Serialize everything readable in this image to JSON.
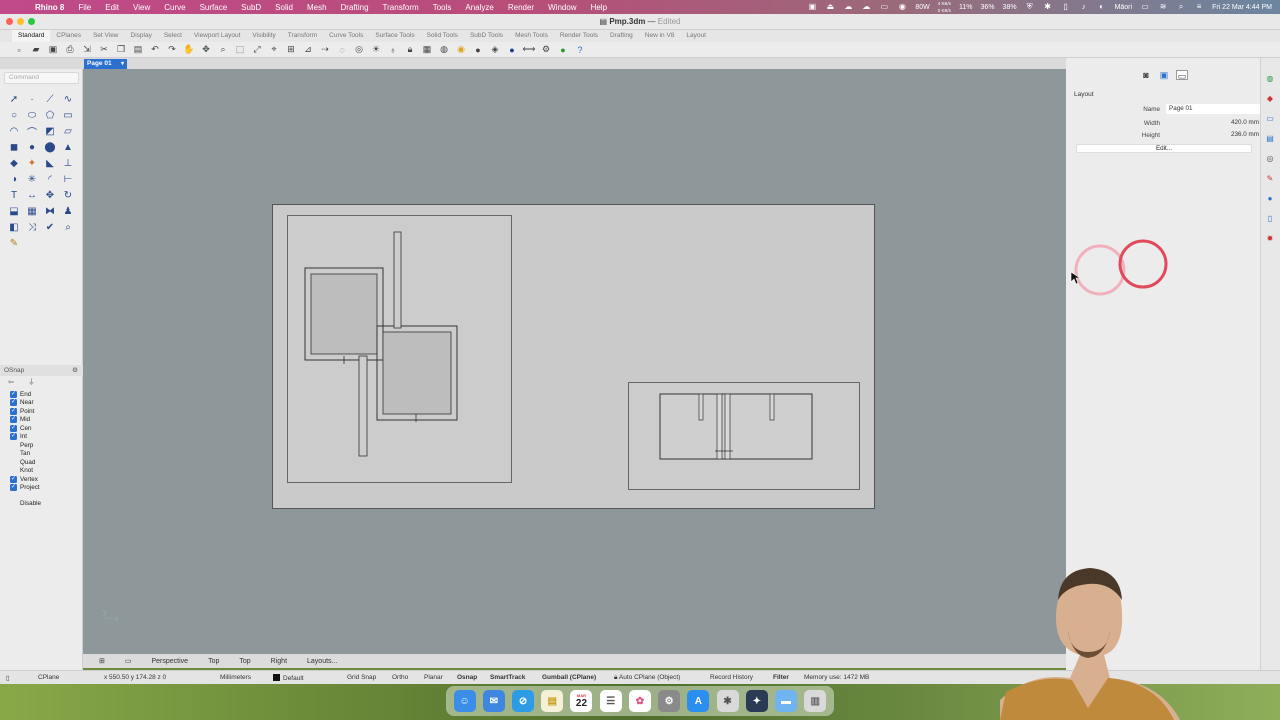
{
  "menubar": {
    "app": "Rhino 8",
    "items": [
      "File",
      "Edit",
      "View",
      "Curve",
      "Surface",
      "SubD",
      "Solid",
      "Mesh",
      "Drafting",
      "Transform",
      "Tools",
      "Analyze",
      "Render",
      "Window",
      "Help"
    ],
    "net_up": "4 KB/s",
    "net_down": "0 KB/s",
    "cpu_pct": "11%",
    "mem_pct": "36%",
    "other_pct": "38%",
    "battery_w": "80W",
    "keyboard": "Māori",
    "datetime": "Fri 22 Mar  4:44 PM"
  },
  "titlebar": {
    "filename": "Pmp.3dm",
    "status": "Edited"
  },
  "toolbar_tabs": [
    "Standard",
    "CPlanes",
    "Set View",
    "Display",
    "Select",
    "Viewport Layout",
    "Visibility",
    "Transform",
    "Curve Tools",
    "Surface Tools",
    "Solid Tools",
    "SubD Tools",
    "Mesh Tools",
    "Render Tools",
    "Drafting",
    "New in V8",
    "Layout"
  ],
  "page_tab": "Page 01",
  "command_placeholder": "Command",
  "osnap": {
    "title": "OSnap",
    "items": [
      {
        "label": "End",
        "checked": true
      },
      {
        "label": "Near",
        "checked": true
      },
      {
        "label": "Point",
        "checked": true
      },
      {
        "label": "Mid",
        "checked": true
      },
      {
        "label": "Cen",
        "checked": true
      },
      {
        "label": "Int",
        "checked": true
      },
      {
        "label": "Perp",
        "checked": false
      },
      {
        "label": "Tan",
        "checked": false
      },
      {
        "label": "Quad",
        "checked": false
      },
      {
        "label": "Knot",
        "checked": false
      },
      {
        "label": "Vertex",
        "checked": true
      },
      {
        "label": "Project",
        "checked": true
      }
    ],
    "disable_label": "Disable"
  },
  "layout_panel": {
    "section": "Layout",
    "name_label": "Name",
    "name_value": "Page 01",
    "width_label": "Width",
    "width_value": "420.0 mm",
    "height_label": "Height",
    "height_value": "236.0 mm",
    "edit_label": "Edit..."
  },
  "view_tabs": [
    "Perspective",
    "Top",
    "Top",
    "Right",
    "Layouts..."
  ],
  "status": {
    "cplane": "CPlane",
    "coords": "x 550.50  y 174.28  z 0",
    "units": "Millimeters",
    "layer": "Default",
    "grid_snap": "Grid Snap",
    "ortho": "Ortho",
    "planar": "Planar",
    "osnap": "Osnap",
    "smarttrack": "SmartTrack",
    "gumball": "Gumball (CPlane)",
    "autocplane": "Auto CPlane (Object)",
    "record_history": "Record History",
    "filter": "Filter",
    "memory": "Memory use: 1472 MB"
  },
  "dock": {
    "calendar_month": "MAR",
    "calendar_day": "22"
  },
  "colors": {
    "accent": "#2b6fcf",
    "viewport_bg": "#8e989b",
    "paper": "#cacaca",
    "highlight_circle": "#e04a5a"
  }
}
